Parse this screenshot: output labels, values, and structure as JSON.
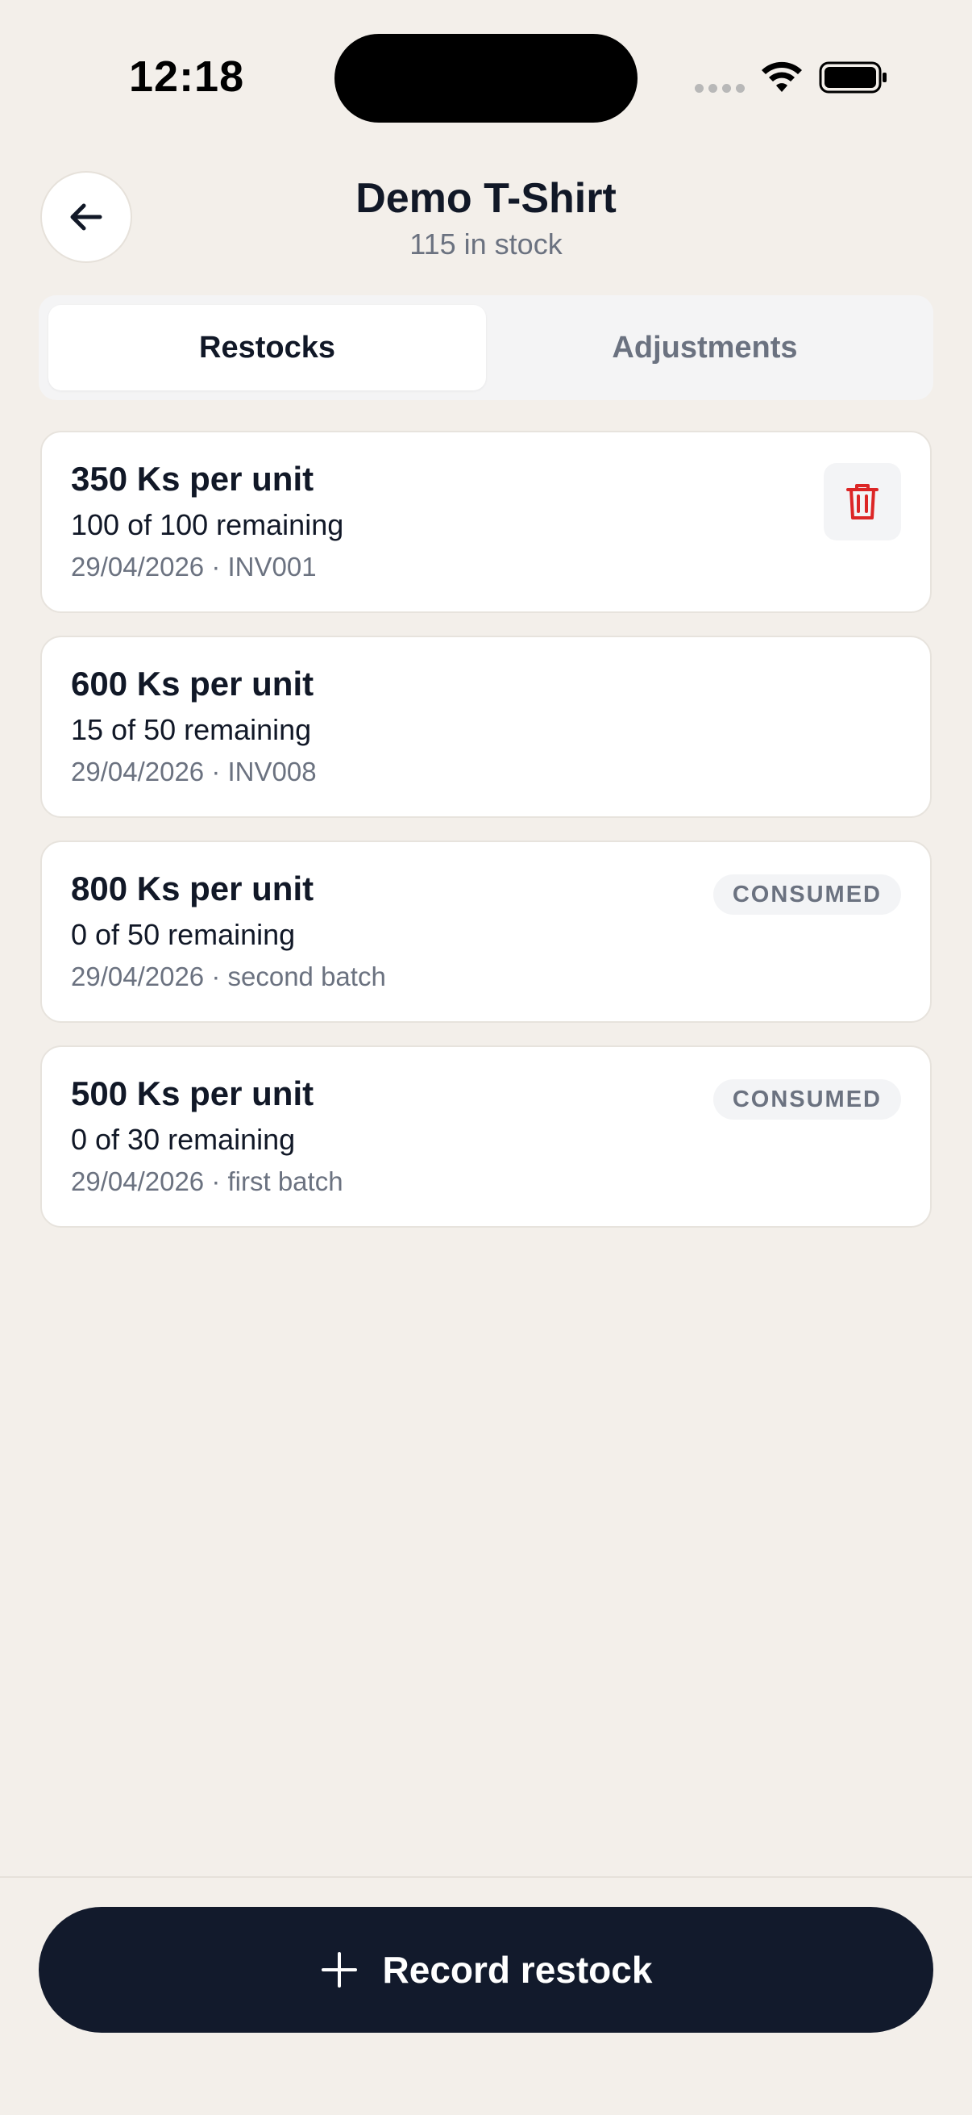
{
  "status_bar": {
    "time": "12:18"
  },
  "header": {
    "title": "Demo T-Shirt",
    "subtitle": "115 in stock",
    "back_icon": "arrow-left-icon"
  },
  "tabs": [
    {
      "label": "Restocks",
      "active": true
    },
    {
      "label": "Adjustments",
      "active": false
    }
  ],
  "restocks": [
    {
      "price": "350 Ks per unit",
      "remaining": "100 of 100 remaining",
      "meta": "29/04/2026 · INV001",
      "action_icon": "trash-icon"
    },
    {
      "price": "600 Ks per unit",
      "remaining": "15 of 50 remaining",
      "meta": "29/04/2026 · INV008"
    },
    {
      "price": "800 Ks per unit",
      "remaining": "0 of 50 remaining",
      "meta": "29/04/2026 · second batch",
      "badge": "CONSUMED"
    },
    {
      "price": "500 Ks per unit",
      "remaining": "0 of 30 remaining",
      "meta": "29/04/2026 · first batch",
      "badge": "CONSUMED"
    }
  ],
  "primary_action": {
    "label": "Record restock",
    "icon": "plus-icon"
  },
  "colors": {
    "background": "#f3efea",
    "primary": "#121a2c",
    "danger": "#dc2626",
    "muted_text": "#6b7280"
  }
}
